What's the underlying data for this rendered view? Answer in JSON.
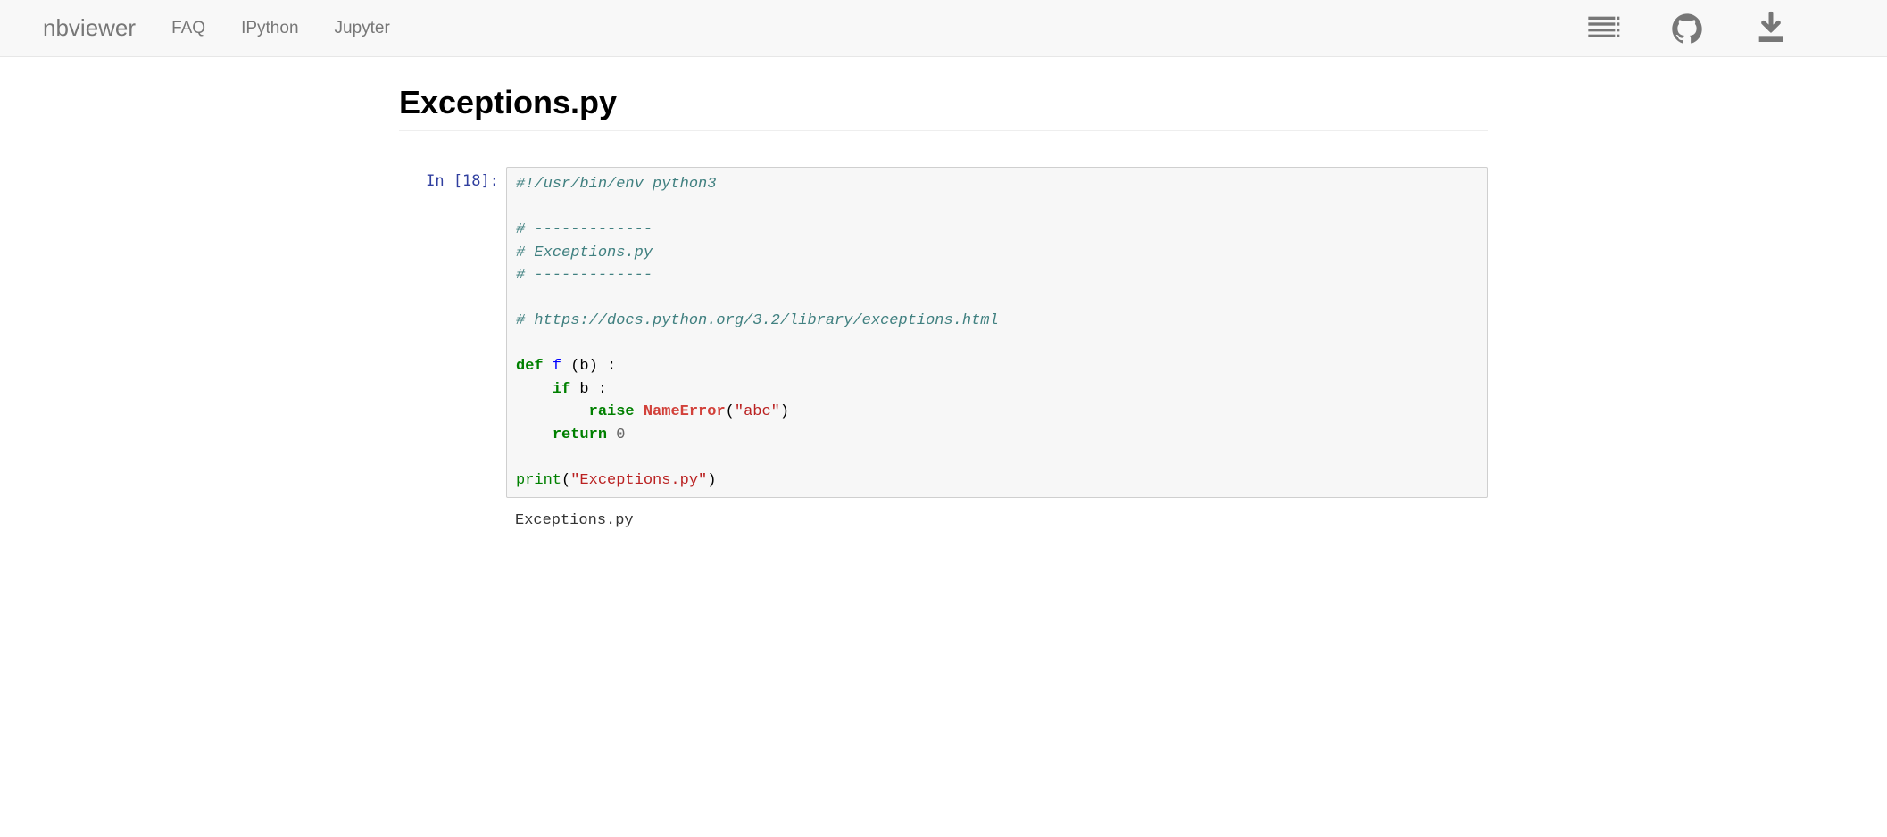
{
  "navbar": {
    "brand": "nbviewer",
    "links": [
      "FAQ",
      "IPython",
      "Jupyter"
    ],
    "icons": [
      "jupyterhub-icon",
      "github-icon",
      "download-icon"
    ]
  },
  "notebook": {
    "title": "Exceptions.py",
    "cell": {
      "execution_count": 18,
      "prompt": "In [18]:",
      "output": "Exceptions.py",
      "source": {
        "l1_comment": "#!/usr/bin/env python3",
        "l2_comment": "# -------------",
        "l3_comment": "# Exceptions.py",
        "l4_comment": "# -------------",
        "l5_comment": "# https://docs.python.org/3.2/library/exceptions.html",
        "kw_def": "def",
        "fn_name": "f",
        "param": "b",
        "kw_if": "if",
        "kw_raise": "raise",
        "exc": "NameError",
        "str_abc": "\"abc\"",
        "kw_return": "return",
        "lit_zero": "0",
        "fn_print": "print",
        "str_exc": "\"Exceptions.py\""
      }
    }
  }
}
